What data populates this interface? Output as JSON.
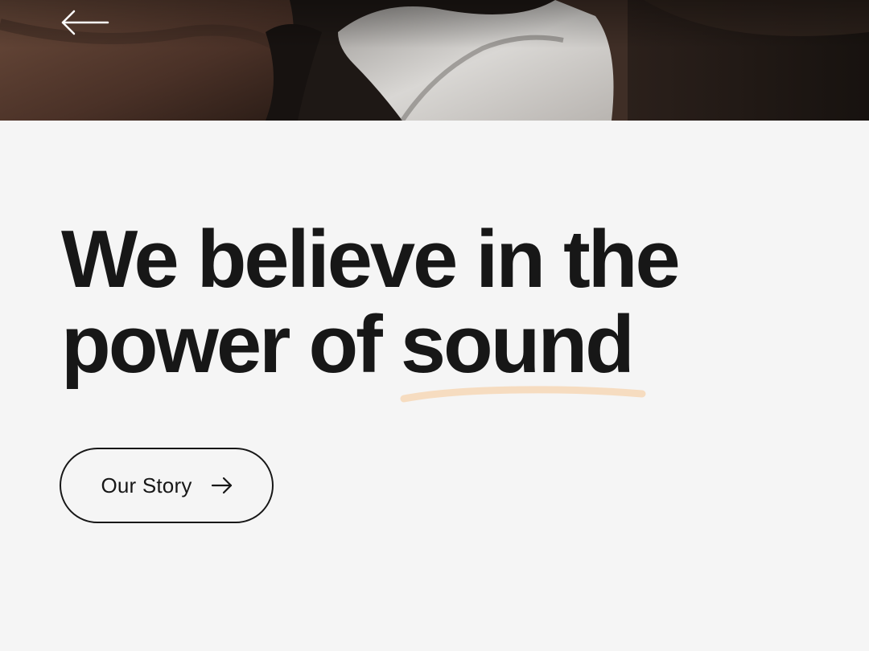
{
  "hero": {
    "back_icon": "arrow-left-icon"
  },
  "main": {
    "headline_line1": "We believe in the",
    "headline_line2_prefix": "power of ",
    "headline_highlight": "sound",
    "highlight_color": "#f6dcc0",
    "text_color": "#171717",
    "background_color": "#f5f5f5"
  },
  "cta": {
    "label": "Our Story",
    "icon": "arrow-right-icon"
  }
}
